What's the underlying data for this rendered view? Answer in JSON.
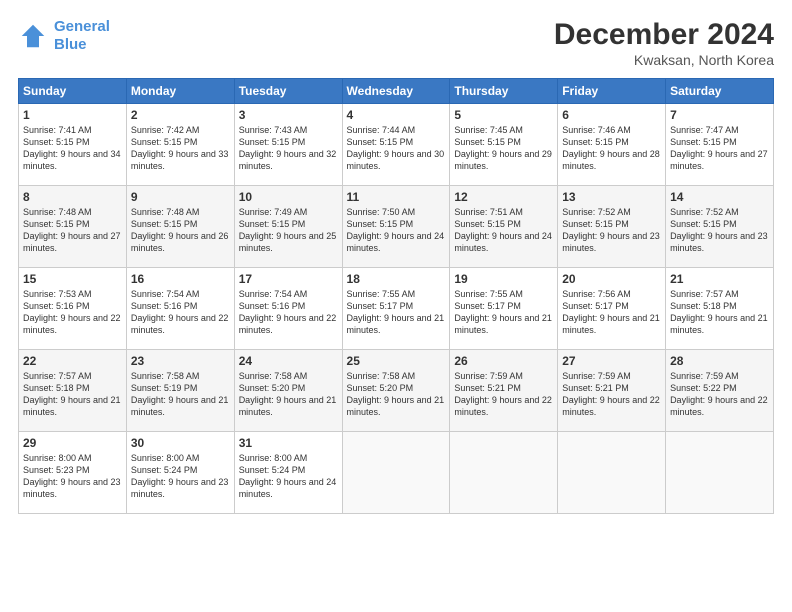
{
  "logo": {
    "line1": "General",
    "line2": "Blue"
  },
  "header": {
    "month": "December 2024",
    "location": "Kwaksan, North Korea"
  },
  "weekdays": [
    "Sunday",
    "Monday",
    "Tuesday",
    "Wednesday",
    "Thursday",
    "Friday",
    "Saturday"
  ],
  "weeks": [
    [
      {
        "day": "1",
        "sunrise": "7:41 AM",
        "sunset": "5:15 PM",
        "daylight": "9 hours and 34 minutes."
      },
      {
        "day": "2",
        "sunrise": "7:42 AM",
        "sunset": "5:15 PM",
        "daylight": "9 hours and 33 minutes."
      },
      {
        "day": "3",
        "sunrise": "7:43 AM",
        "sunset": "5:15 PM",
        "daylight": "9 hours and 32 minutes."
      },
      {
        "day": "4",
        "sunrise": "7:44 AM",
        "sunset": "5:15 PM",
        "daylight": "9 hours and 30 minutes."
      },
      {
        "day": "5",
        "sunrise": "7:45 AM",
        "sunset": "5:15 PM",
        "daylight": "9 hours and 29 minutes."
      },
      {
        "day": "6",
        "sunrise": "7:46 AM",
        "sunset": "5:15 PM",
        "daylight": "9 hours and 28 minutes."
      },
      {
        "day": "7",
        "sunrise": "7:47 AM",
        "sunset": "5:15 PM",
        "daylight": "9 hours and 27 minutes."
      }
    ],
    [
      {
        "day": "8",
        "sunrise": "7:48 AM",
        "sunset": "5:15 PM",
        "daylight": "9 hours and 27 minutes."
      },
      {
        "day": "9",
        "sunrise": "7:48 AM",
        "sunset": "5:15 PM",
        "daylight": "9 hours and 26 minutes."
      },
      {
        "day": "10",
        "sunrise": "7:49 AM",
        "sunset": "5:15 PM",
        "daylight": "9 hours and 25 minutes."
      },
      {
        "day": "11",
        "sunrise": "7:50 AM",
        "sunset": "5:15 PM",
        "daylight": "9 hours and 24 minutes."
      },
      {
        "day": "12",
        "sunrise": "7:51 AM",
        "sunset": "5:15 PM",
        "daylight": "9 hours and 24 minutes."
      },
      {
        "day": "13",
        "sunrise": "7:52 AM",
        "sunset": "5:15 PM",
        "daylight": "9 hours and 23 minutes."
      },
      {
        "day": "14",
        "sunrise": "7:52 AM",
        "sunset": "5:15 PM",
        "daylight": "9 hours and 23 minutes."
      }
    ],
    [
      {
        "day": "15",
        "sunrise": "7:53 AM",
        "sunset": "5:16 PM",
        "daylight": "9 hours and 22 minutes."
      },
      {
        "day": "16",
        "sunrise": "7:54 AM",
        "sunset": "5:16 PM",
        "daylight": "9 hours and 22 minutes."
      },
      {
        "day": "17",
        "sunrise": "7:54 AM",
        "sunset": "5:16 PM",
        "daylight": "9 hours and 22 minutes."
      },
      {
        "day": "18",
        "sunrise": "7:55 AM",
        "sunset": "5:17 PM",
        "daylight": "9 hours and 21 minutes."
      },
      {
        "day": "19",
        "sunrise": "7:55 AM",
        "sunset": "5:17 PM",
        "daylight": "9 hours and 21 minutes."
      },
      {
        "day": "20",
        "sunrise": "7:56 AM",
        "sunset": "5:17 PM",
        "daylight": "9 hours and 21 minutes."
      },
      {
        "day": "21",
        "sunrise": "7:57 AM",
        "sunset": "5:18 PM",
        "daylight": "9 hours and 21 minutes."
      }
    ],
    [
      {
        "day": "22",
        "sunrise": "7:57 AM",
        "sunset": "5:18 PM",
        "daylight": "9 hours and 21 minutes."
      },
      {
        "day": "23",
        "sunrise": "7:58 AM",
        "sunset": "5:19 PM",
        "daylight": "9 hours and 21 minutes."
      },
      {
        "day": "24",
        "sunrise": "7:58 AM",
        "sunset": "5:20 PM",
        "daylight": "9 hours and 21 minutes."
      },
      {
        "day": "25",
        "sunrise": "7:58 AM",
        "sunset": "5:20 PM",
        "daylight": "9 hours and 21 minutes."
      },
      {
        "day": "26",
        "sunrise": "7:59 AM",
        "sunset": "5:21 PM",
        "daylight": "9 hours and 22 minutes."
      },
      {
        "day": "27",
        "sunrise": "7:59 AM",
        "sunset": "5:21 PM",
        "daylight": "9 hours and 22 minutes."
      },
      {
        "day": "28",
        "sunrise": "7:59 AM",
        "sunset": "5:22 PM",
        "daylight": "9 hours and 22 minutes."
      }
    ],
    [
      {
        "day": "29",
        "sunrise": "8:00 AM",
        "sunset": "5:23 PM",
        "daylight": "9 hours and 23 minutes."
      },
      {
        "day": "30",
        "sunrise": "8:00 AM",
        "sunset": "5:24 PM",
        "daylight": "9 hours and 23 minutes."
      },
      {
        "day": "31",
        "sunrise": "8:00 AM",
        "sunset": "5:24 PM",
        "daylight": "9 hours and 24 minutes."
      },
      null,
      null,
      null,
      null
    ]
  ]
}
